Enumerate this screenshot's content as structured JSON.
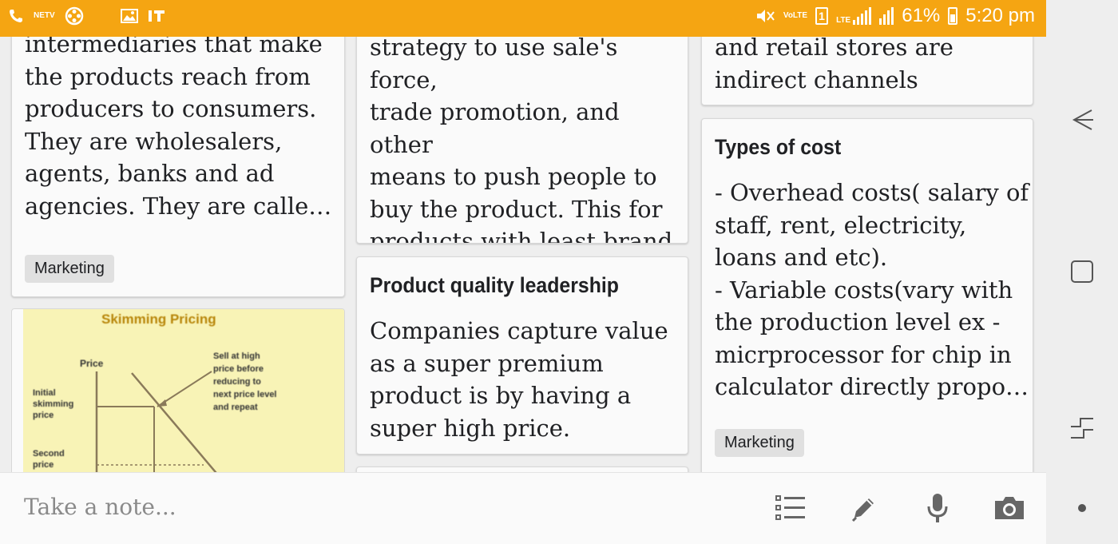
{
  "status_bar": {
    "volte_label": "VoLTE",
    "lte_label": "LTE",
    "sim_number": "1",
    "battery_percent": "61%",
    "time": "5:20 pm",
    "background_color": "#f5a512"
  },
  "notes": [
    {
      "id": "distribution-channels",
      "title": "",
      "body": "intermediaries that make\nthe products reach from\nproducers to consumers.\nThey are wholesalers,\nagents, banks and ad\nagencies. They are calle…",
      "label": "Marketing"
    },
    {
      "id": "push-strategy",
      "title": "",
      "body": "strategy to use sale's force,\ntrade promotion, and other\nmeans to push people to\nbuy the product. This for\nproducts with least brand\nloyalty. …",
      "label": ""
    },
    {
      "id": "retail-channels",
      "title": "",
      "body": "and retail stores are\nindirect channels",
      "label": ""
    },
    {
      "id": "product-quality-leadership",
      "title": "Product quality leadership",
      "body": "Companies capture value\nas a super premium\nproduct is by having a\nsuper high price.",
      "label": ""
    },
    {
      "id": "types-of-cost",
      "title": "Types of cost",
      "body": "- Overhead costs( salary of\nstaff, rent, electricity,\nloans and etc).\n- Variable costs(vary with\nthe production level ex -\nmicrprocessor for chip in\ncalculator directly propo…",
      "label": "Marketing"
    }
  ],
  "skimming_image": {
    "title": "Skimming Pricing",
    "axis_label": "Price",
    "initial_label": "Initial\nskimming\nprice",
    "second_label": "Second\nprice",
    "annotation": "Sell at high\nprice before\nreducing to\nnext price level\nand repeat"
  },
  "bottom_bar": {
    "placeholder": "Take a note...",
    "tools": [
      "checklist-icon",
      "pen-icon",
      "mic-icon",
      "camera-icon"
    ]
  },
  "nav": [
    "back-icon",
    "home-icon",
    "recents-icon",
    "dot-icon"
  ]
}
